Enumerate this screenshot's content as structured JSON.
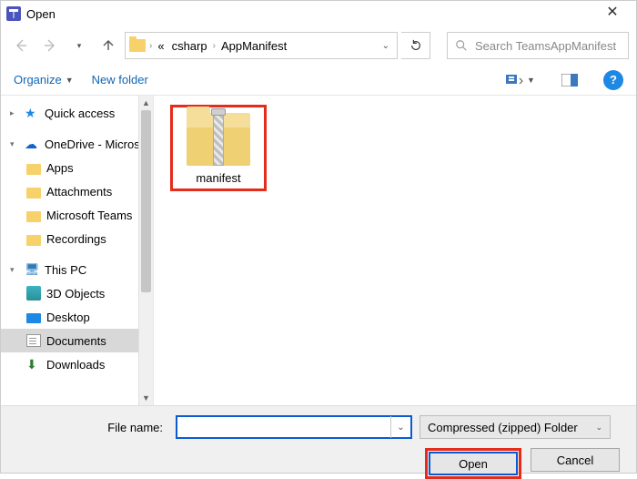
{
  "title": "Open",
  "breadcrumb": {
    "prefix": "«",
    "seg1": "csharp",
    "seg2": "AppManifest"
  },
  "search": {
    "placeholder": "Search TeamsAppManifest"
  },
  "toolbar": {
    "organize": "Organize",
    "new_folder": "New folder"
  },
  "tree": {
    "quick": "Quick access",
    "onedrive": "OneDrive - Microsoft",
    "apps": "Apps",
    "attachments": "Attachments",
    "msteams": "Microsoft Teams",
    "recordings": "Recordings",
    "thispc": "This PC",
    "objects3d": "3D Objects",
    "desktop": "Desktop",
    "documents": "Documents",
    "downloads": "Downloads"
  },
  "file": {
    "name": "manifest"
  },
  "footer": {
    "filename_label": "File name:",
    "filename_value": "",
    "filter": "Compressed (zipped) Folder",
    "open": "Open",
    "cancel": "Cancel"
  }
}
